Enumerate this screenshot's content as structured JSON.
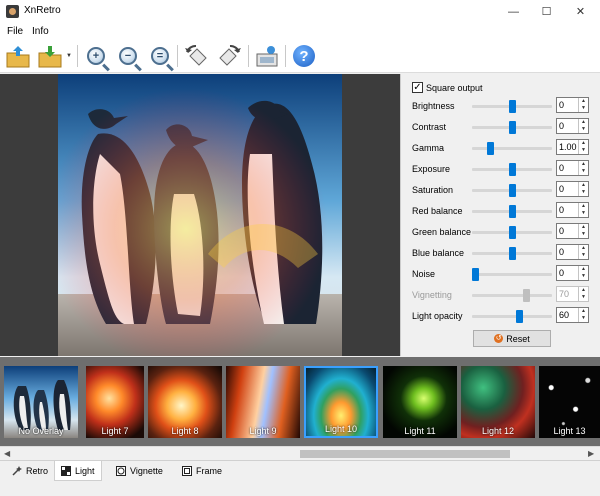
{
  "window": {
    "title": "XnRetro",
    "minimize": "—",
    "maximize": "☐",
    "close": "✕"
  },
  "menu": {
    "file": "File",
    "info": "Info"
  },
  "toolbar": {
    "icons": [
      "open-icon",
      "save-icon",
      "zoom-in-icon",
      "zoom-out-icon",
      "zoom-fit-icon",
      "rotate-left-icon",
      "rotate-right-icon",
      "export-icon",
      "help-icon"
    ],
    "help_label": "?"
  },
  "panel": {
    "square_output": {
      "label": "Square output",
      "checked": true,
      "check": "✓"
    },
    "sliders": [
      {
        "label": "Brightness",
        "value": "0",
        "level": 0.5,
        "enabled": true
      },
      {
        "label": "Contrast",
        "value": "0",
        "level": 0.5,
        "enabled": true
      },
      {
        "label": "Gamma",
        "value": "1.00",
        "level": 0.21,
        "enabled": true
      },
      {
        "label": "Exposure",
        "value": "0",
        "level": 0.5,
        "enabled": true
      },
      {
        "label": "Saturation",
        "value": "0",
        "level": 0.5,
        "enabled": true
      },
      {
        "label": "Red balance",
        "value": "0",
        "level": 0.5,
        "enabled": true
      },
      {
        "label": "Green balance",
        "value": "0",
        "level": 0.5,
        "enabled": true
      },
      {
        "label": "Blue balance",
        "value": "0",
        "level": 0.5,
        "enabled": true
      },
      {
        "label": "Noise",
        "value": "0",
        "level": 0.0,
        "enabled": true
      },
      {
        "label": "Vignetting",
        "value": "70",
        "level": 0.7,
        "enabled": false
      },
      {
        "label": "Light opacity",
        "value": "60",
        "level": 0.6,
        "enabled": true
      }
    ],
    "reset": "Reset"
  },
  "overlays": [
    {
      "label": "No Overlay",
      "selected": false
    },
    {
      "label": "Light 7",
      "selected": false
    },
    {
      "label": "Light 8",
      "selected": false
    },
    {
      "label": "Light 9",
      "selected": false
    },
    {
      "label": "Light 10",
      "selected": true
    },
    {
      "label": "Light 11",
      "selected": false
    },
    {
      "label": "Light 12",
      "selected": false
    },
    {
      "label": "Light 13",
      "selected": false
    }
  ],
  "tabs": [
    {
      "label": "Retro",
      "active": false
    },
    {
      "label": "Light",
      "active": true
    },
    {
      "label": "Vignette",
      "active": false
    },
    {
      "label": "Frame",
      "active": false
    }
  ],
  "colors": {
    "accent": "#0078d7",
    "preview_bg": "#3c3c3c",
    "strip_bg": "#6e6e6e",
    "selection": "#3aa0ff"
  }
}
